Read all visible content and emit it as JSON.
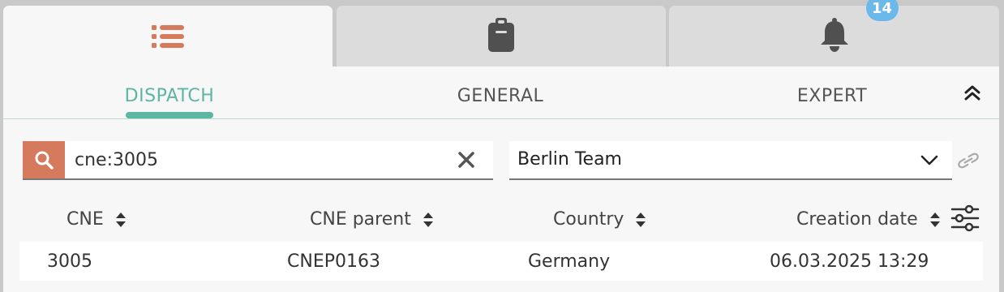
{
  "top_tabs": [
    {
      "icon": "list-icon",
      "active": true
    },
    {
      "icon": "clipboard-icon",
      "active": false
    },
    {
      "icon": "bell-icon",
      "active": false,
      "badge": "14"
    }
  ],
  "sub_tabs": [
    {
      "label": "DISPATCH",
      "active": true
    },
    {
      "label": "GENERAL",
      "active": false
    },
    {
      "label": "EXPERT",
      "active": false
    }
  ],
  "search": {
    "value": "cne:3005"
  },
  "team_select": {
    "value": "Berlin Team"
  },
  "table": {
    "columns": [
      "CNE",
      "CNE parent",
      "Country",
      "Creation date"
    ],
    "rows": [
      [
        "3005",
        "CNEP0163",
        "Germany",
        "06.03.2025 13:29"
      ]
    ]
  },
  "colors": {
    "accent_teal": "#5cb6a2",
    "accent_orange": "#d57a5c",
    "badge_blue": "#6bb8ea"
  }
}
